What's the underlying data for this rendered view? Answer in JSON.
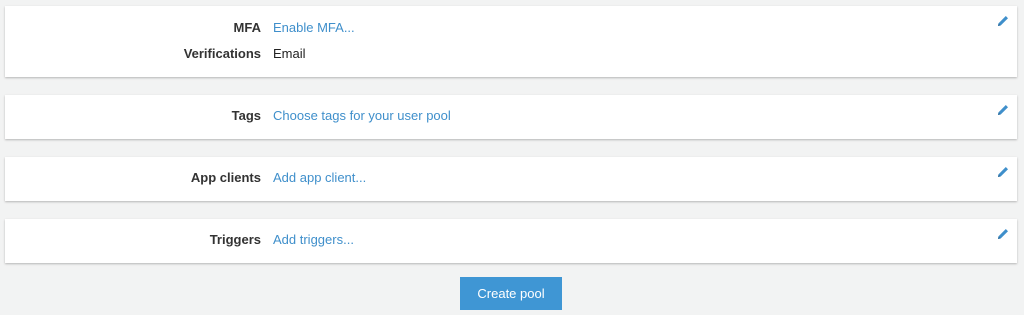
{
  "sections": [
    {
      "rows": [
        {
          "label": "MFA",
          "value": "Enable MFA...",
          "is_link": true
        },
        {
          "label": "Verifications",
          "value": "Email",
          "is_link": false
        }
      ]
    },
    {
      "rows": [
        {
          "label": "Tags",
          "value": "Choose tags for your user pool",
          "is_link": true
        }
      ]
    },
    {
      "rows": [
        {
          "label": "App clients",
          "value": "Add app client...",
          "is_link": true
        }
      ]
    },
    {
      "rows": [
        {
          "label": "Triggers",
          "value": "Add triggers...",
          "is_link": true
        }
      ]
    }
  ],
  "edit_icon": "pencil-icon",
  "create_button_label": "Create pool",
  "colors": {
    "link": "#3f8fcb",
    "button": "#3f96d4",
    "background": "#f2f3f3",
    "icon": "#3f8fcb"
  }
}
